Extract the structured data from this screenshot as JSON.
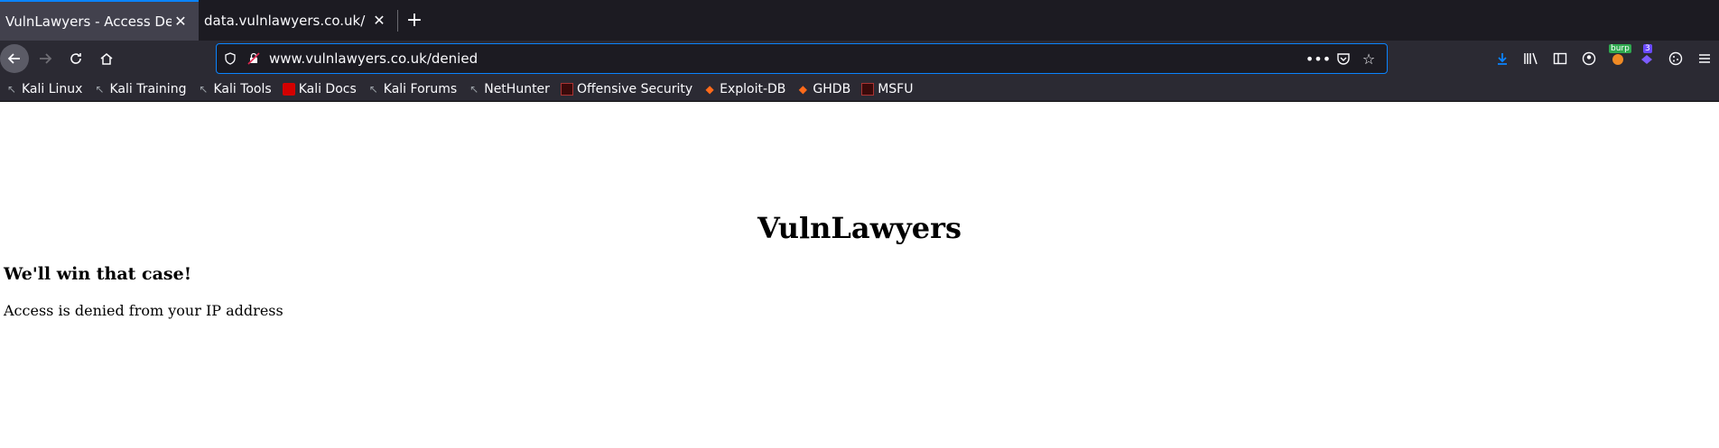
{
  "tabs": [
    {
      "title": "VulnLawyers - Access Denied",
      "active": true
    },
    {
      "title": "data.vulnlawyers.co.uk/",
      "active": false
    }
  ],
  "urlbar": {
    "url": "www.vulnlawyers.co.uk/denied"
  },
  "toolbar": {
    "burp_badge": "burp",
    "ext_badge": "3"
  },
  "bookmarks": [
    {
      "label": "Kali Linux",
      "icon": "dragon"
    },
    {
      "label": "Kali Training",
      "icon": "dragon"
    },
    {
      "label": "Kali Tools",
      "icon": "dragon"
    },
    {
      "label": "Kali Docs",
      "icon": "red"
    },
    {
      "label": "Kali Forums",
      "icon": "dragon"
    },
    {
      "label": "NetHunter",
      "icon": "dragon"
    },
    {
      "label": "Offensive Security",
      "icon": "dark"
    },
    {
      "label": "Exploit-DB",
      "icon": "orange"
    },
    {
      "label": "GHDB",
      "icon": "orange"
    },
    {
      "label": "MSFU",
      "icon": "dark"
    }
  ],
  "page": {
    "site_title": "VulnLawyers",
    "tagline": "We'll win that case!",
    "message": "Access is denied from your IP address"
  },
  "colors": {
    "accent": "#0a84ff",
    "chrome_dark": "#1c1b22",
    "chrome": "#2b2a33"
  }
}
